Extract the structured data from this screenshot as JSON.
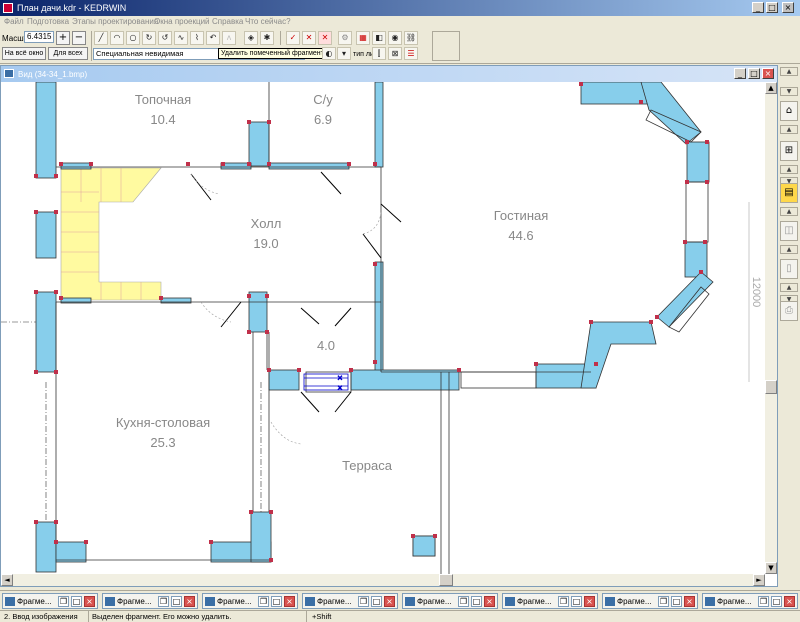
{
  "window": {
    "title": "План дачи.kdr - KEDRWIN",
    "min_label": "_",
    "max_label": "□",
    "close_label": "×"
  },
  "menu": [
    "Файл",
    "Подготовка",
    "Этапы проектирования",
    "Окна проекций",
    "Справка",
    "Что сейчас?"
  ],
  "toolbar": {
    "scale_label": "Масшт",
    "scale_value": "6.4315",
    "zoom_in": "+",
    "zoom_out": "−",
    "fit_window_label": "На всё окно",
    "fit_all_label": "Для всех",
    "line_type_value": "Специальная невидимая",
    "tooltip": "Удалить помеченный фрагмент",
    "line_type_label": "тип линии"
  },
  "mdi": {
    "title": "Вид (34-34_1.bmp)"
  },
  "rooms": {
    "topochnaya": "Топочная",
    "topochnaya_area": "10.4",
    "su": "С/у",
    "su_area": "6.9",
    "hall": "Холл",
    "hall_area": "19.0",
    "gostinaya": "Гостиная",
    "gostinaya_area": "44.6",
    "small_area": "4.0",
    "kitchen": "Кухня-столовая",
    "kitchen_area": "25.3",
    "terrace": "Терраса",
    "dimension": "12000"
  },
  "taskbar": {
    "items": [
      "Фрагме...",
      "Фрагме...",
      "Фрагме...",
      "Фрагме...",
      "Фрагме...",
      "Фрагме...",
      "Фрагме...",
      "Фрагме..."
    ]
  },
  "status": {
    "step": "2. Ввод изображения",
    "message": "Выделен фрагмент. Его можно удалить.",
    "modifier": "+Shift"
  },
  "colors": {
    "wall": "#87ceeb",
    "stair": "#fffaa0",
    "node": "#c0304a",
    "accent": "#0a246a"
  }
}
